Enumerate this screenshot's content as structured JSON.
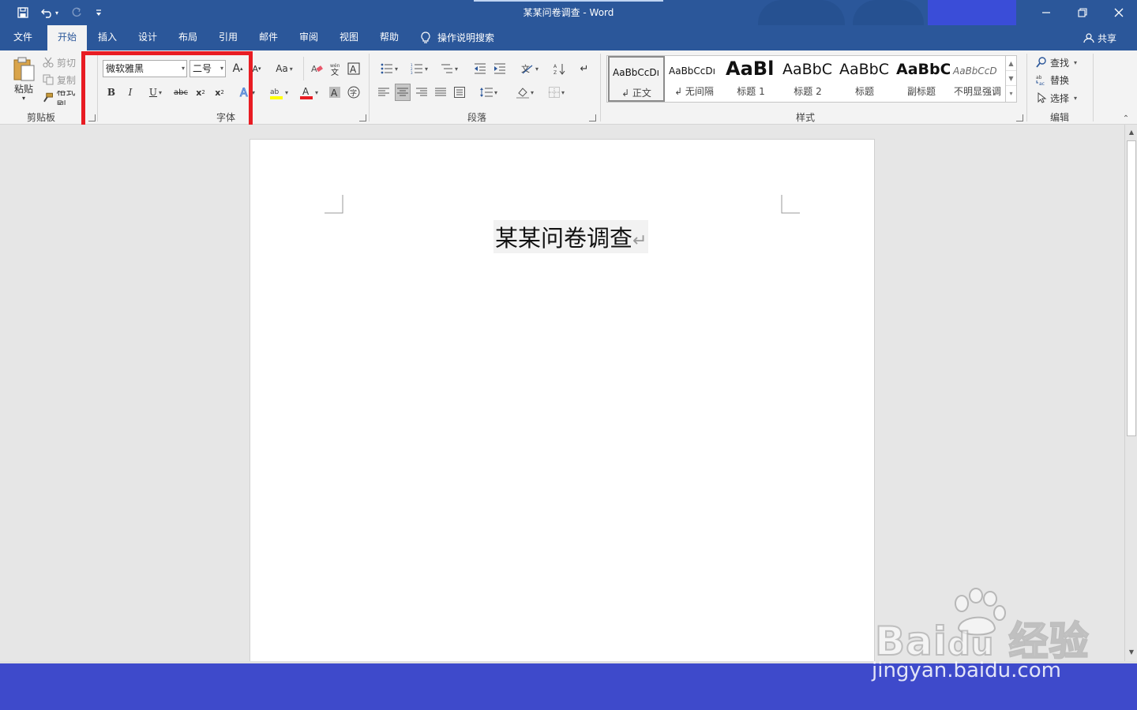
{
  "window": {
    "title": "某某问卷调查 - Word"
  },
  "tabs": [
    {
      "label": "文件"
    },
    {
      "label": "开始"
    },
    {
      "label": "插入"
    },
    {
      "label": "设计"
    },
    {
      "label": "布局"
    },
    {
      "label": "引用"
    },
    {
      "label": "邮件"
    },
    {
      "label": "审阅"
    },
    {
      "label": "视图"
    },
    {
      "label": "帮助"
    }
  ],
  "tell_me": "操作说明搜索",
  "share": "共享",
  "clipboard": {
    "paste": "粘贴",
    "cut": "剪切",
    "copy": "复制",
    "format_painter": "格式刷",
    "group": "剪贴板"
  },
  "font": {
    "name": "微软雅黑",
    "size": "二号",
    "group": "字体"
  },
  "paragraph": {
    "group": "段落"
  },
  "styles": {
    "group": "样式",
    "items": [
      {
        "preview": "AaBbCcDı",
        "name": "↲ 正文"
      },
      {
        "preview": "AaBbCcDı",
        "name": "↲ 无间隔"
      },
      {
        "preview": "AaBl",
        "name": "标题 1"
      },
      {
        "preview": "AaBbC",
        "name": "标题 2"
      },
      {
        "preview": "AaBbC",
        "name": "标题"
      },
      {
        "preview": "AaBbC",
        "name": "副标题"
      },
      {
        "preview": "AaBbCcD",
        "name": "不明显强调"
      }
    ]
  },
  "editing": {
    "find": "查找",
    "replace": "替换",
    "select": "选择",
    "group": "编辑"
  },
  "document": {
    "title": "某某问卷调查"
  },
  "watermark": {
    "url": "jingyan.baidu.com"
  },
  "colors": {
    "word_blue": "#2b579a",
    "highlight_red": "#e81c23",
    "bottom_bar": "#3e4acb"
  }
}
